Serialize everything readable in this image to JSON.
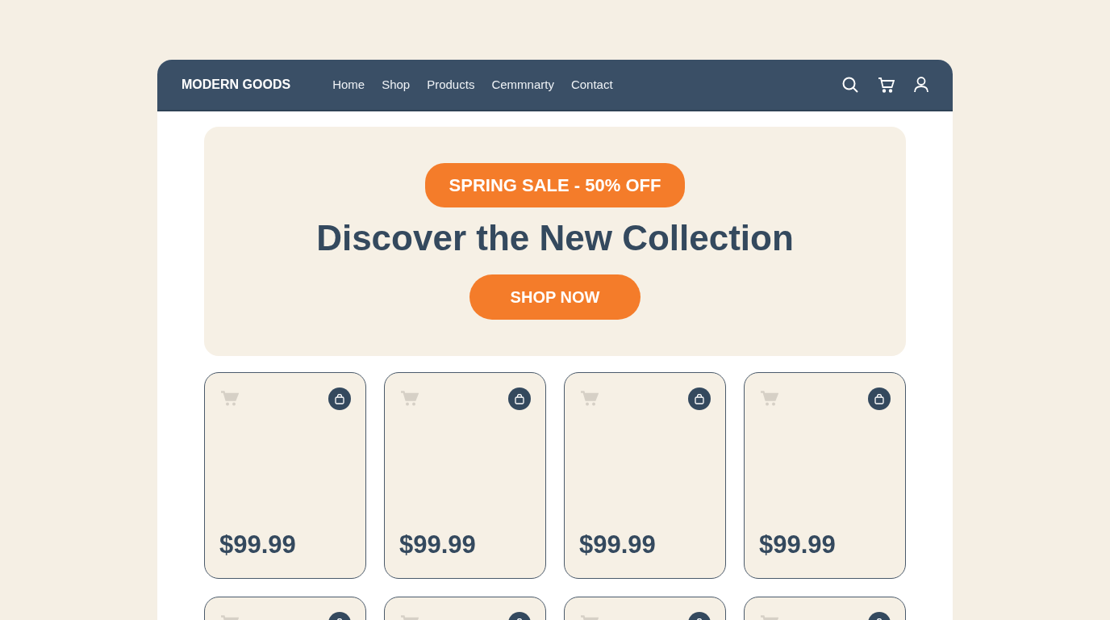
{
  "navbar": {
    "brand": "MODERN GOODS",
    "links": [
      {
        "label": "Home"
      },
      {
        "label": "Shop"
      },
      {
        "label": "Products"
      },
      {
        "label": "Cemmnarty"
      },
      {
        "label": "Contact"
      }
    ]
  },
  "hero": {
    "badge": "SPRING SALE - 50% OFF",
    "heading": "Discover the New Collection",
    "button": "SHOP NOW"
  },
  "products": [
    {
      "kind": "full",
      "price": "$99.99"
    },
    {
      "kind": "full",
      "price": "$99.99"
    },
    {
      "kind": "full",
      "price": "$99.99"
    },
    {
      "kind": "full",
      "price": "$99.99"
    },
    {
      "kind": "partial"
    },
    {
      "kind": "partial"
    },
    {
      "kind": "partial"
    },
    {
      "kind": "partial"
    }
  ]
}
